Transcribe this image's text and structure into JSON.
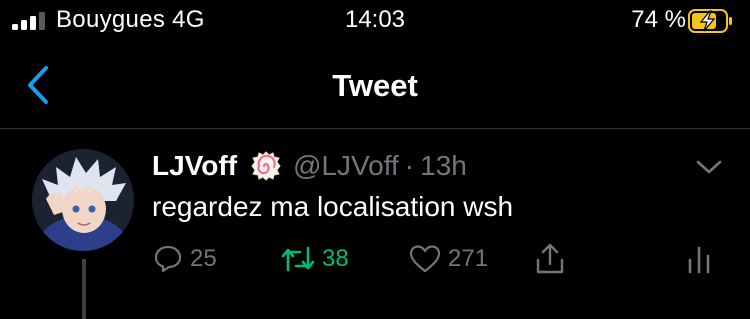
{
  "status_bar": {
    "carrier": "Bouygues",
    "network": "4G",
    "time": "14:03",
    "battery_percent": "74 %",
    "signal_bars": 3,
    "battery_level": 0.74,
    "battery_state": "charging"
  },
  "nav": {
    "title": "Tweet",
    "back_icon": "chevron-left-icon"
  },
  "tweet": {
    "display_name": "LJVoff",
    "name_emoji": "fish-cake-icon",
    "handle": "@LJVoff",
    "separator": "·",
    "time_ago": "13h",
    "text": "regardez ma localisation wsh",
    "actions": {
      "replies": "25",
      "retweets": "38",
      "likes": "271"
    }
  },
  "colors": {
    "background": "#000000",
    "text": "#ffffff",
    "secondary": "#71767b",
    "accent": "#1d9bf0",
    "retweet": "#00ba7c",
    "battery_charging": "#f5c518"
  }
}
